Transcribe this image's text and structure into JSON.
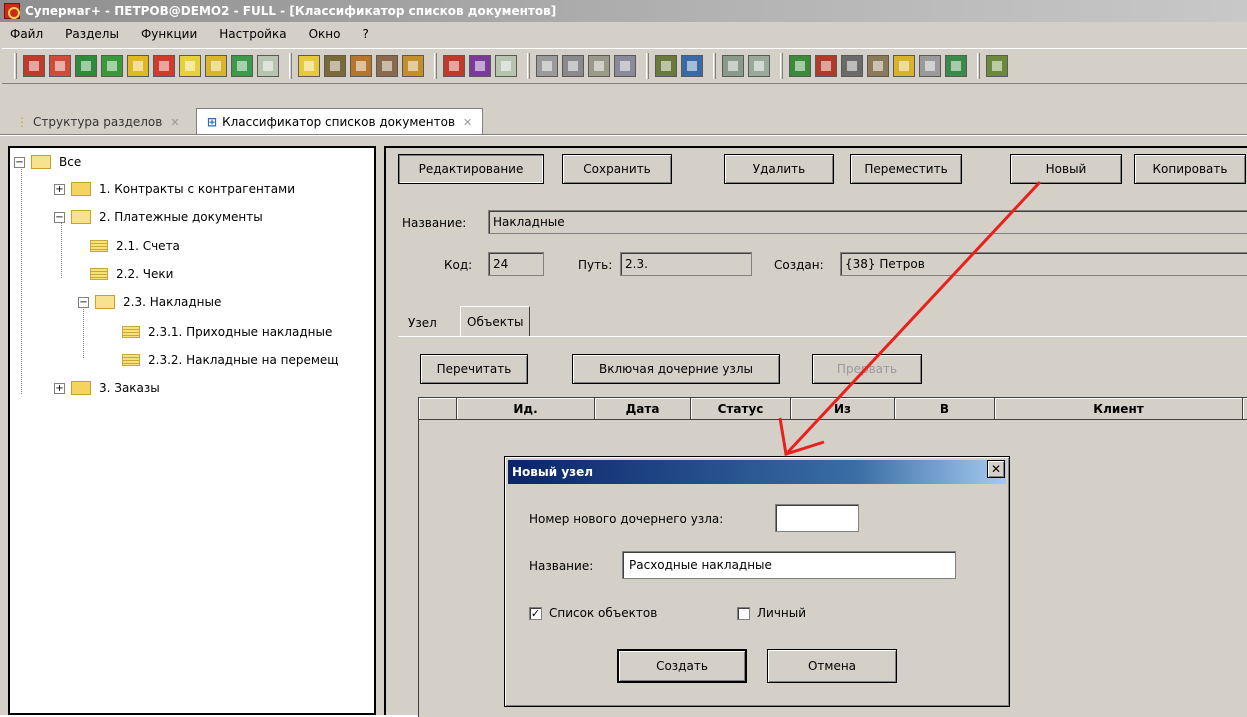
{
  "window": {
    "title": "Супермаг+ - ПЕТРОВ@DEMO2 - FULL - [Классификатор списков документов]"
  },
  "menu": [
    "Файл",
    "Разделы",
    "Функции",
    "Настройка",
    "Окно",
    "?"
  ],
  "tabs": [
    {
      "label": "Структура разделов"
    },
    {
      "label": "Классификатор списков документов"
    }
  ],
  "tree": {
    "items": [
      {
        "label": "Все"
      },
      {
        "label": "1. Контракты с контрагентами"
      },
      {
        "label": "2. Платежные документы"
      },
      {
        "label": "2.1. Счета"
      },
      {
        "label": "2.2. Чеки"
      },
      {
        "label": "2.3. Накладные"
      },
      {
        "label": "2.3.1. Приходные накладные"
      },
      {
        "label": "2.3.2. Накладные на перемещ"
      },
      {
        "label": "3. Заказы"
      }
    ]
  },
  "toolbar": {
    "edit": "Редактирование",
    "save": "Сохранить",
    "delete": "Удалить",
    "move": "Переместить",
    "new": "Новый",
    "copy": "Копировать"
  },
  "details": {
    "name_label": "Название:",
    "name_value": "Накладные",
    "code_label": "Код:",
    "code_value": "24",
    "path_label": "Путь:",
    "path_value": "2.3.",
    "created_label": "Создан:",
    "created_value": "{38} Петров"
  },
  "subtabs": [
    {
      "label": "Узел"
    },
    {
      "label": "Объекты"
    }
  ],
  "objects": {
    "reread": "Перечитать",
    "include_children": "Включая дочерние узлы",
    "interrupt": "Прервать",
    "columns": [
      "Ид.",
      "Дата",
      "Статус",
      "Из",
      "В",
      "Клиент"
    ]
  },
  "dialog": {
    "title": "Новый узел",
    "child_number_label": "Номер нового дочернего узла:",
    "child_number_value": "",
    "name_label": "Название:",
    "name_value": "Расходные накладные",
    "list_objects_label": "Список объектов",
    "list_objects_checked": true,
    "personal_label": "Личный",
    "personal_checked": false,
    "create": "Создать",
    "cancel": "Отмена"
  },
  "colors": {
    "annotation_arrow": "#e8211c",
    "dialog_title": "#0a246a",
    "window_bg": "#d4d0c8"
  }
}
